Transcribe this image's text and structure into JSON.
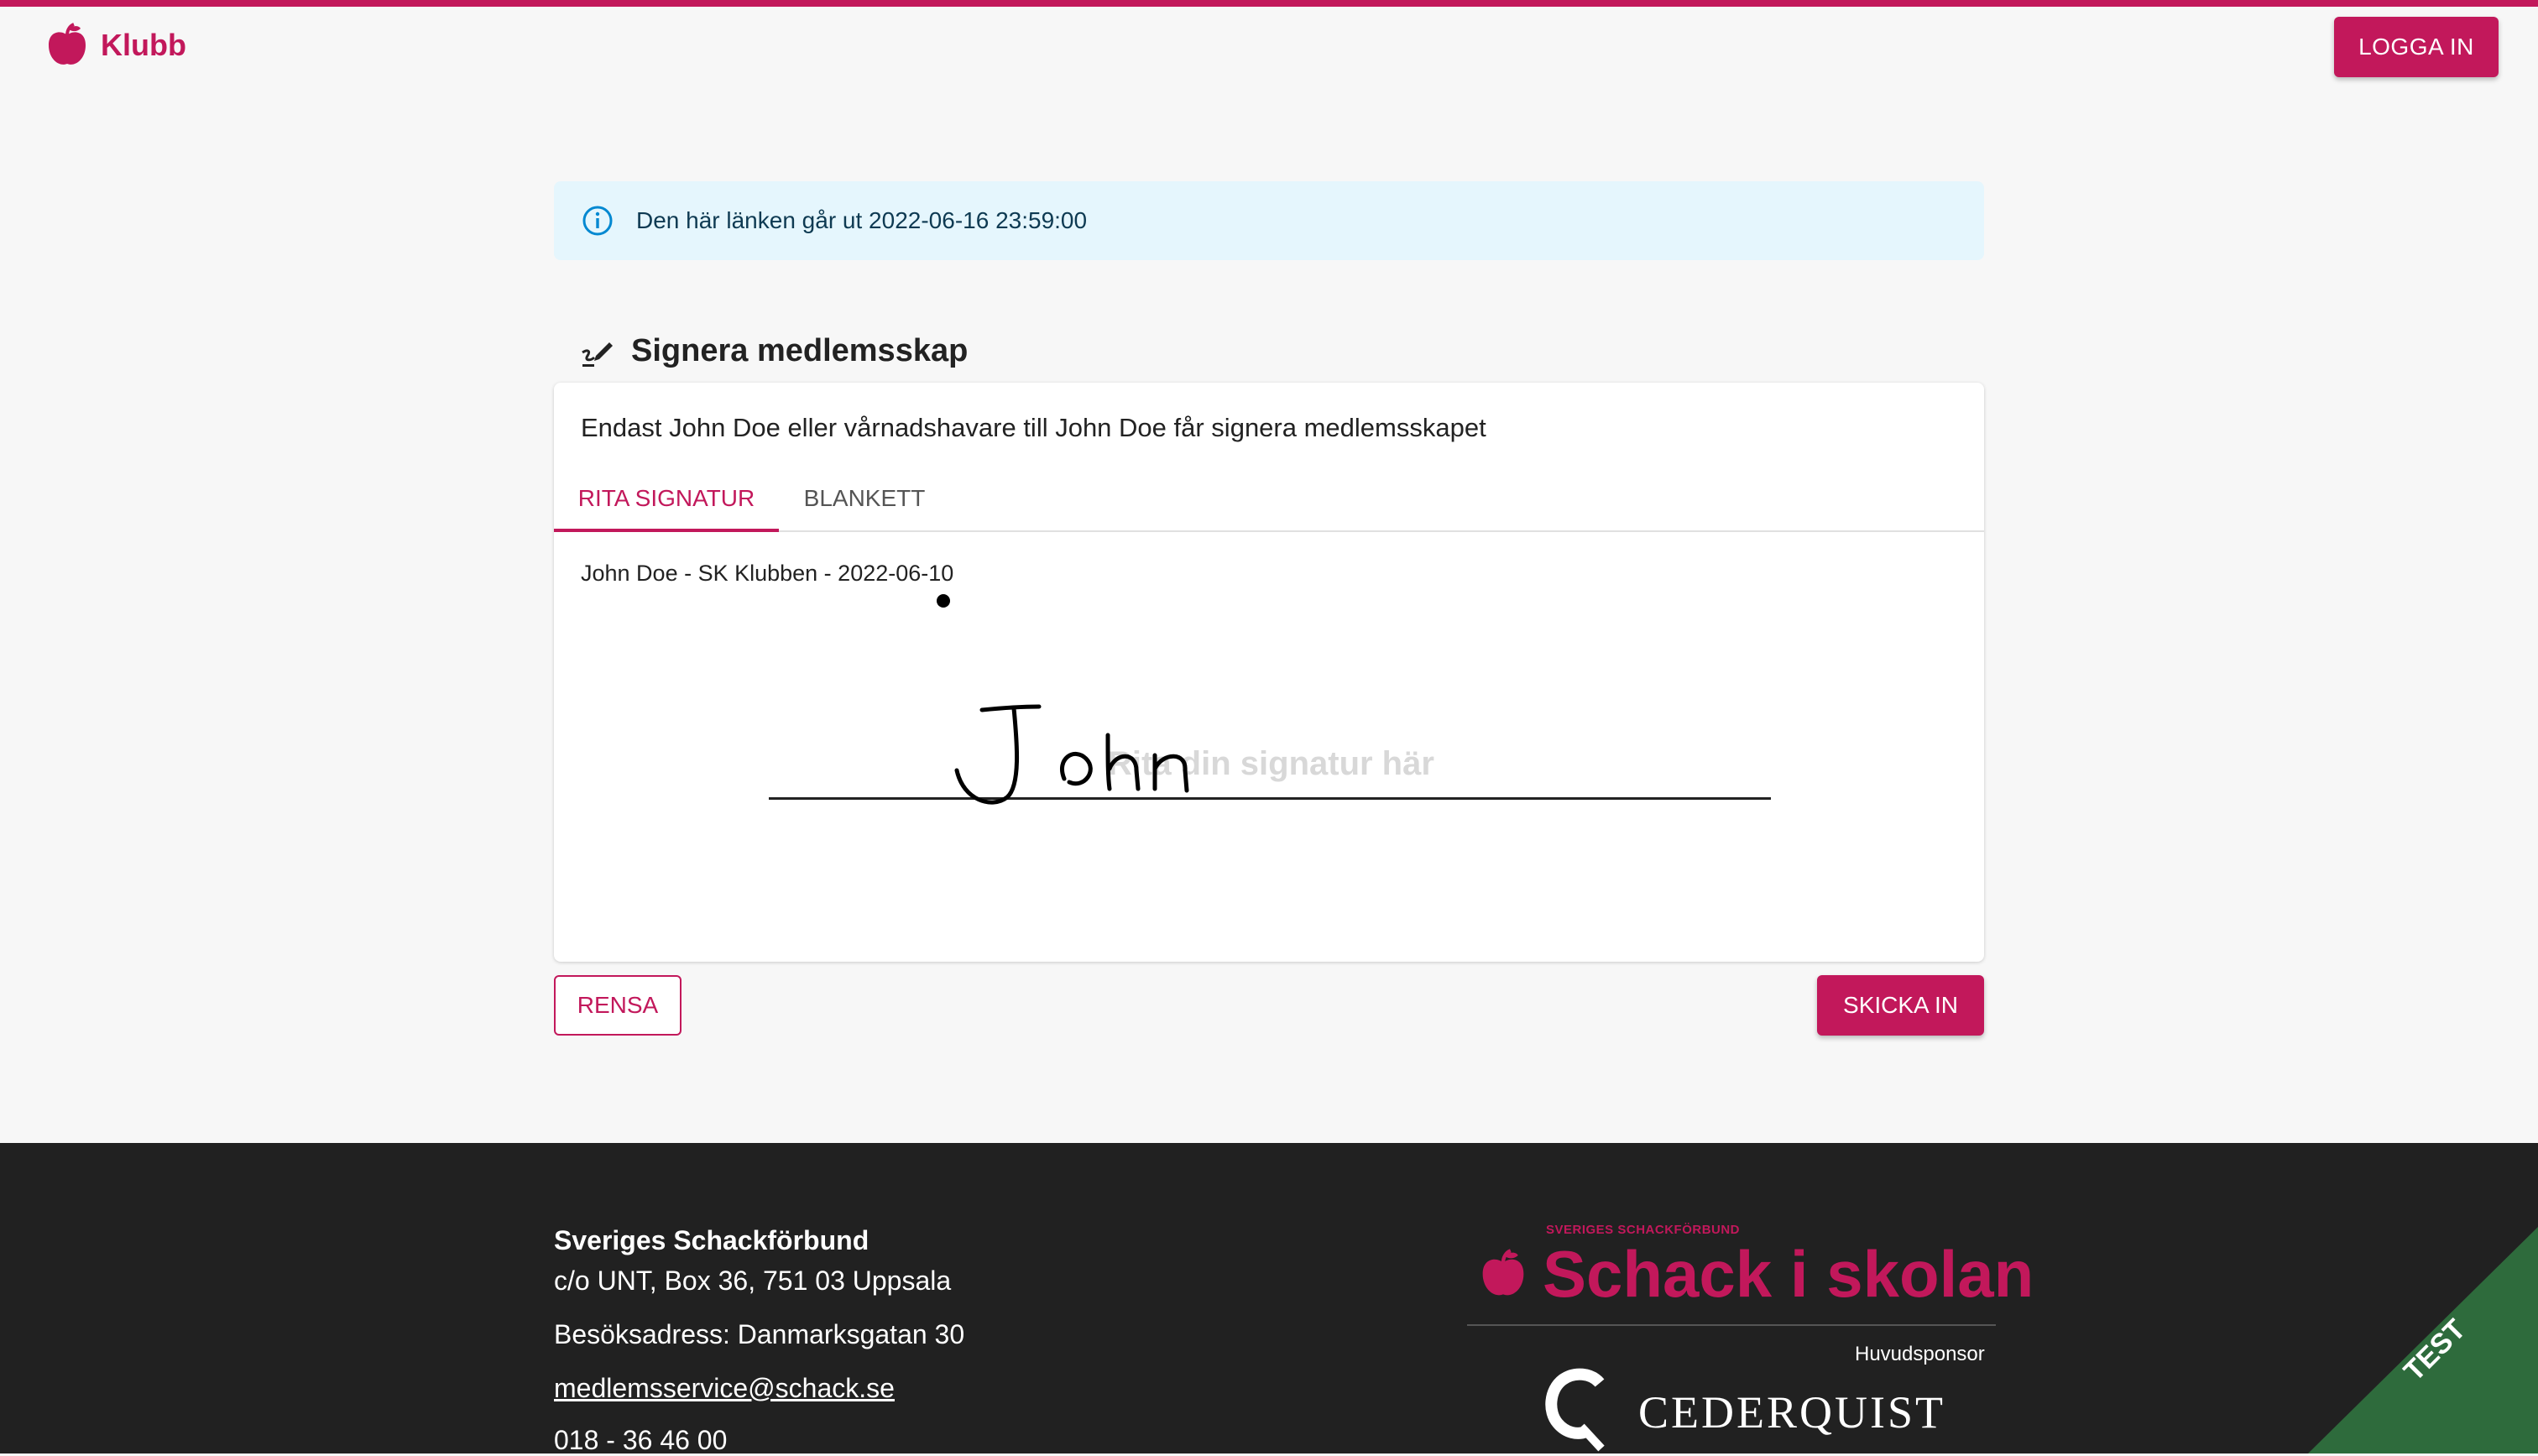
{
  "header": {
    "brand": "Klubb",
    "login_label": "LOGGA IN"
  },
  "alert": {
    "text": "Den här länken går ut 2022-06-16 23:59:00"
  },
  "section": {
    "title": "Signera medlemsskap"
  },
  "card": {
    "notice": "Endast John Doe eller vårnadshavare till John Doe får signera medlemsskapet",
    "tabs": [
      {
        "label": "RITA SIGNATUR",
        "active": true
      },
      {
        "label": "BLANKETT",
        "active": false
      }
    ],
    "signature_caption": "John Doe - SK Klubben - 2022-06-10",
    "signature_placeholder": "Rita din signatur här"
  },
  "actions": {
    "clear_label": "RENSA",
    "submit_label": "SKICKA IN"
  },
  "footer": {
    "org_name": "Sveriges Schackförbund",
    "address": "c/o UNT, Box 36, 751 03 Uppsala",
    "visit_address": "Besöksadress: Danmarksgatan 30",
    "email": "medlemsservice@schack.se",
    "phone": "018 - 36 46 00",
    "partner_small": "SVERIGES SCHACKFÖRBUND",
    "partner_name": "Schack i skolan",
    "sponsor_label": "Huvudsponsor",
    "sponsor_name": "CEDERQUIST"
  },
  "environment_badge": "TEST",
  "colors": {
    "brand": "#c2185b",
    "alert_bg": "#e5f6fd",
    "footer_bg": "#212121",
    "badge_bg": "#2e6b3c"
  }
}
